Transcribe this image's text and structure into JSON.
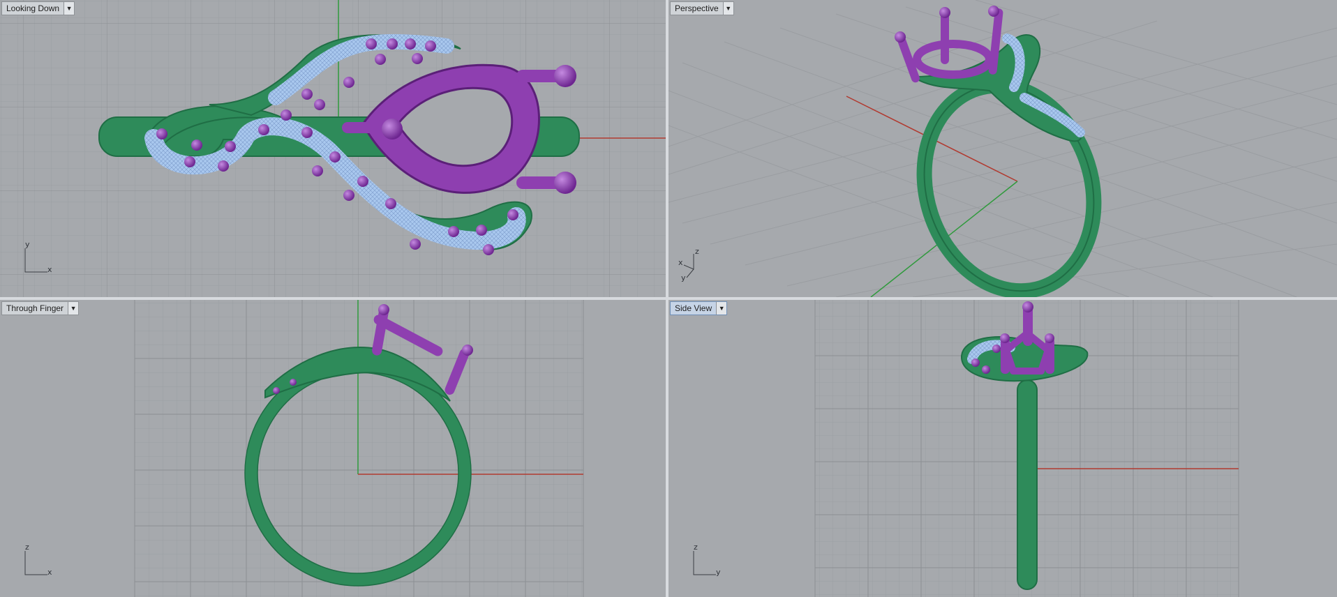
{
  "viewports": [
    {
      "id": "top",
      "title": "Looking Down",
      "menu_icon": "dropdown-arrow-icon",
      "active": false,
      "axes": [
        "y",
        "x"
      ]
    },
    {
      "id": "persp",
      "title": "Perspective",
      "menu_icon": "dropdown-arrow-icon",
      "active": false,
      "axes": [
        "z",
        "x",
        "y"
      ]
    },
    {
      "id": "front",
      "title": "Through Finger",
      "menu_icon": "dropdown-arrow-icon",
      "active": false,
      "axes": [
        "z",
        "x"
      ]
    },
    {
      "id": "side",
      "title": "Side View",
      "menu_icon": "dropdown-arrow-icon",
      "active": true,
      "axes": [
        "z",
        "y"
      ]
    }
  ],
  "colors": {
    "viewport_bg": "#a6a9ad",
    "grid_minor": "#9b9ea2",
    "grid_major": "#8c8f93",
    "x_axis": "#b13a30",
    "y_axis": "#2f9a3c",
    "band_green": "#2e8b5a",
    "prong_purple": "#8e3fb0",
    "gem_blue": "#a9c8ee"
  }
}
